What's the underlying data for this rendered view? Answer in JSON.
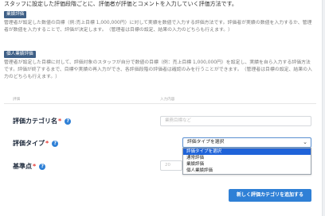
{
  "intro_text": "スタッフに設定した評価段階ごとに、評価者が評価とコメントを入力していく評価方法です。",
  "sections": [
    {
      "badge": "業績評価",
      "description": "管理者が設定した数値の目標（例:売上目標 1,000,000円）に対して実績を数値で入力する評価方法です。評価者が実績の数値を入力するか、管理者が数値を入力することで、評価が決定します。（管理者は目標の設定、結果の入力のどちらも行えます。）"
    },
    {
      "badge": "個人業績評価",
      "description": "管理者が設定した目標に対して、評価対象のスタッフが自分で数値の目標（例：売上目標 1,000,000円）を設定し、実績を自ら入力する評価方法です。評価が終了するまで、目標や実績の再入力ができ、各評価段階の評価者は確認のみを行うことができます。（管理者は目標の設定、結果の入力のどちらも行えます。）"
    }
  ],
  "table_header": {
    "col1": "評価",
    "col2": "入力内容"
  },
  "form": {
    "category_name": {
      "label": "評価カテゴリ名",
      "required": "*",
      "placeholder": "業務目標など"
    },
    "evaluation_type": {
      "label": "評価タイプ",
      "required": "*",
      "selected": "評価タイプを選択",
      "options": [
        "評価タイプを選択",
        "通常評価",
        "業績評価",
        "個人業績評価"
      ]
    },
    "base_score": {
      "label": "基準点",
      "required": "*",
      "placeholder": "20"
    }
  },
  "add_button": "新しく評価カテゴリを追加する",
  "help_glyph": "?",
  "chevron_glyph": "⌄"
}
